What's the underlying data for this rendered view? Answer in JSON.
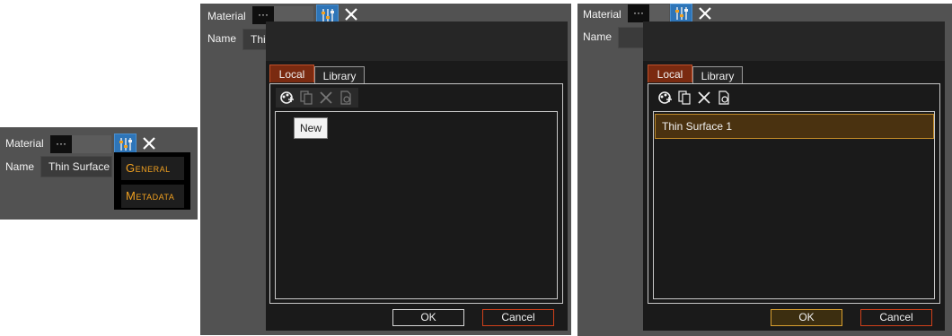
{
  "panel1": {
    "material_label": "Material",
    "dots_label": "···",
    "name_label": "Name",
    "name_value": "Thin Surface",
    "menu": [
      "General",
      "Metadata"
    ]
  },
  "panel2": {
    "material_label": "Material",
    "dots_label": "···",
    "name_label": "Name",
    "name_value": "Thi",
    "tabs": [
      "Local",
      "Library"
    ],
    "tooltip": "New",
    "ok_label": "OK",
    "cancel_label": "Cancel"
  },
  "panel3": {
    "material_label": "Material",
    "dots_label": "···",
    "name_label": "Name",
    "tabs": [
      "Local",
      "Library"
    ],
    "list_items": [
      "Thin Surface 1"
    ],
    "ok_label": "OK",
    "cancel_label": "Cancel"
  },
  "colors": {
    "accent_orange": "#f0a020",
    "tab_active": "#7a2a10",
    "selection_gold": "#c08a28",
    "cancel_border": "#d0401a",
    "blue_button": "#2e75b8"
  },
  "icons": [
    "dots-icon",
    "adjust-icon",
    "close-icon",
    "new-material-icon",
    "copy-icon",
    "delete-icon",
    "export-icon"
  ]
}
